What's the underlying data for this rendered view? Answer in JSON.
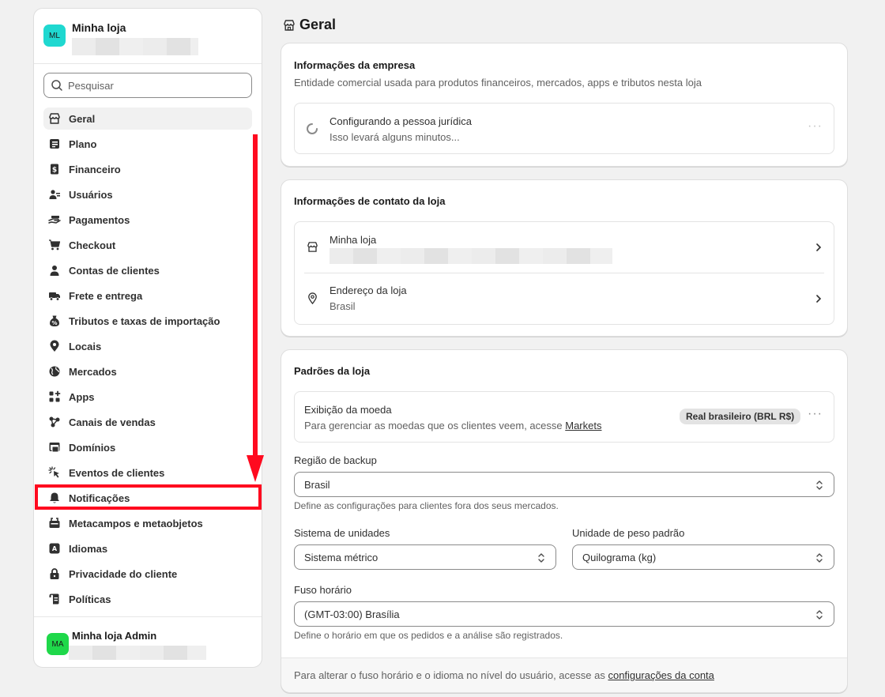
{
  "store": {
    "initials": "ML",
    "name": "Minha loja"
  },
  "search": {
    "placeholder": "Pesquisar"
  },
  "nav": [
    {
      "label": "Geral",
      "icon": "store-icon",
      "active": true
    },
    {
      "label": "Plano",
      "icon": "plan-icon"
    },
    {
      "label": "Financeiro",
      "icon": "finance-icon"
    },
    {
      "label": "Usuários",
      "icon": "users-icon"
    },
    {
      "label": "Pagamentos",
      "icon": "payments-icon"
    },
    {
      "label": "Checkout",
      "icon": "cart-icon"
    },
    {
      "label": "Contas de clientes",
      "icon": "person-icon"
    },
    {
      "label": "Frete e entrega",
      "icon": "truck-icon"
    },
    {
      "label": "Tributos e taxas de importação",
      "icon": "tax-icon"
    },
    {
      "label": "Locais",
      "icon": "location-icon"
    },
    {
      "label": "Mercados",
      "icon": "globe-icon"
    },
    {
      "label": "Apps",
      "icon": "apps-icon"
    },
    {
      "label": "Canais de vendas",
      "icon": "channels-icon"
    },
    {
      "label": "Domínios",
      "icon": "domain-icon"
    },
    {
      "label": "Eventos de clientes",
      "icon": "cursor-icon"
    },
    {
      "label": "Notificações",
      "icon": "bell-icon"
    },
    {
      "label": "Metacampos e metaobjetos",
      "icon": "metafields-icon"
    },
    {
      "label": "Idiomas",
      "icon": "language-icon"
    },
    {
      "label": "Privacidade do cliente",
      "icon": "lock-icon"
    },
    {
      "label": "Políticas",
      "icon": "policy-icon"
    }
  ],
  "admin": {
    "initials": "MA",
    "name": "Minha loja Admin"
  },
  "page": {
    "title": "Geral"
  },
  "company_card": {
    "title": "Informações da empresa",
    "subtitle": "Entidade comercial usada para produtos financeiros, mercados, apps e tributos nesta loja",
    "status_title": "Configurando a pessoa jurídica",
    "status_sub": "Isso levará alguns minutos...",
    "more": "···"
  },
  "contact_card": {
    "title": "Informações de contato da loja",
    "store_row_title": "Minha loja",
    "address_row_title": "Endereço da loja",
    "address_row_value": "Brasil"
  },
  "defaults_card": {
    "title": "Padrões da loja",
    "currency_title": "Exibição da moeda",
    "currency_desc": "Para gerenciar as moedas que os clientes veem, acesse",
    "currency_link": "Markets",
    "currency_badge": "Real brasileiro (BRL R$)",
    "more": "···",
    "backup_label": "Região de backup",
    "backup_value": "Brasil",
    "backup_help": "Define as configurações para clientes fora dos seus mercados.",
    "units_label": "Sistema de unidades",
    "units_value": "Sistema métrico",
    "weight_label": "Unidade de peso padrão",
    "weight_value": "Quilograma (kg)",
    "tz_label": "Fuso horário",
    "tz_value": "(GMT-03:00) Brasília",
    "tz_help": "Define o horário em que os pedidos e a análise são registrados.",
    "footer_text": "Para alterar o fuso horário e o idioma no nível do usuário, acesse as",
    "footer_link": "configurações da conta"
  },
  "colors": {
    "annotation": "#ff0a1f",
    "store_avatar": "#1fd8d0",
    "admin_avatar": "#1fd84a"
  }
}
